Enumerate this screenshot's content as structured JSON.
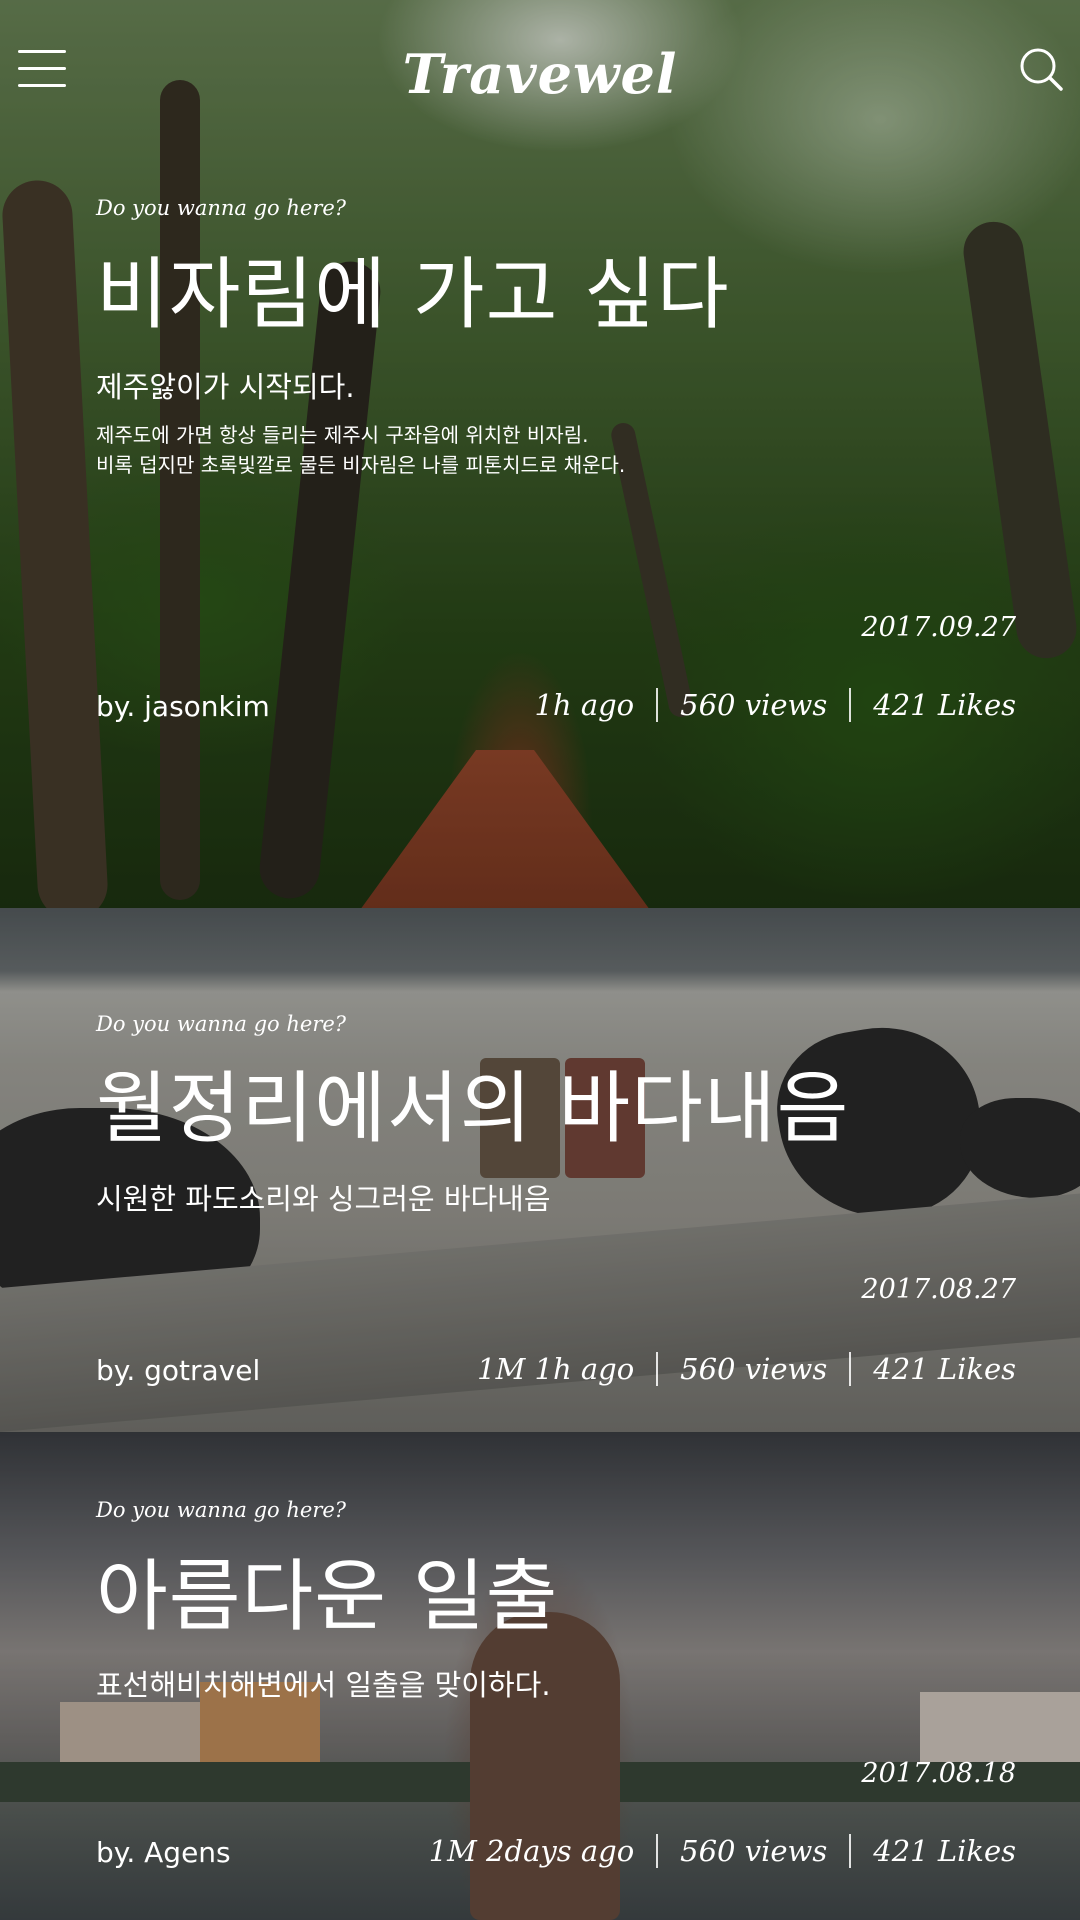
{
  "header": {
    "logo": "Travewel",
    "menu_icon": "hamburger-menu-icon",
    "search_icon": "search-icon"
  },
  "posts": [
    {
      "kicker": "Do you wanna go here?",
      "title": "비자림에 가고 싶다",
      "subtitle": "제주앓이가 시작되다.",
      "description": [
        "제주도에 가면 항상 들리는 제주시 구좌읍에 위치한 비자림.",
        "비록 덥지만 초록빛깔로 물든 비자림은 나를 피톤치드로 채운다."
      ],
      "date": "2017.09.27",
      "author": "by. jasonkim",
      "time": "1h ago",
      "views": "560 views",
      "likes": "421 Likes"
    },
    {
      "kicker": "Do you wanna go here?",
      "title": "월정리에서의 바다내음",
      "subtitle": "시원한 파도소리와 싱그러운 바다내음",
      "date": "2017.08.27",
      "author": "by. gotravel",
      "time": "1M 1h ago",
      "views": "560 views",
      "likes": "421 Likes"
    },
    {
      "kicker": "Do you wanna go here?",
      "title": "아름다운 일출",
      "subtitle": "표선해비치해변에서 일출을 맞이하다.",
      "date": "2017.08.18",
      "author": "by. Agens",
      "time": "1M 2days ago",
      "views": "560 views",
      "likes": "421 Likes"
    }
  ]
}
